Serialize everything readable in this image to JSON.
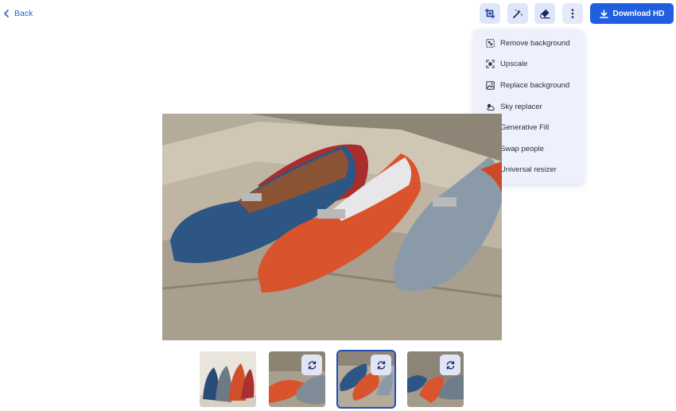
{
  "header": {
    "back_label": "Back",
    "download_label": "Download HD",
    "tools": [
      {
        "name": "crop-tool",
        "icon": "crop-icon"
      },
      {
        "name": "magic-tool",
        "icon": "magic-wand-icon"
      },
      {
        "name": "eraser-tool",
        "icon": "eraser-icon"
      },
      {
        "name": "more-options",
        "icon": "more-vertical-icon"
      }
    ]
  },
  "menu": {
    "items": [
      {
        "label": "Remove background",
        "icon": "remove-background-icon"
      },
      {
        "label": "Upscale",
        "icon": "upscale-icon"
      },
      {
        "label": "Replace background",
        "icon": "replace-background-icon"
      },
      {
        "label": "Sky replacer",
        "icon": "sky-replacer-icon"
      },
      {
        "label": "Generative Fill",
        "icon": "generative-fill-icon"
      },
      {
        "label": "Swap people",
        "icon": "swap-people-icon"
      },
      {
        "label": "Universal resizer",
        "icon": "universal-resizer-icon"
      }
    ]
  },
  "thumbnails": {
    "selected_index": 2,
    "items": [
      {
        "regenerate_icon": null
      },
      {
        "regenerate_icon": "regenerate-icon"
      },
      {
        "regenerate_icon": "regenerate-icon"
      },
      {
        "regenerate_icon": "regenerate-icon"
      }
    ]
  },
  "colors": {
    "accent": "#1f5fe0",
    "link": "#2c5fd9",
    "tool_bg": "#dfe6fb",
    "menu_bg": "#eef1fd"
  }
}
